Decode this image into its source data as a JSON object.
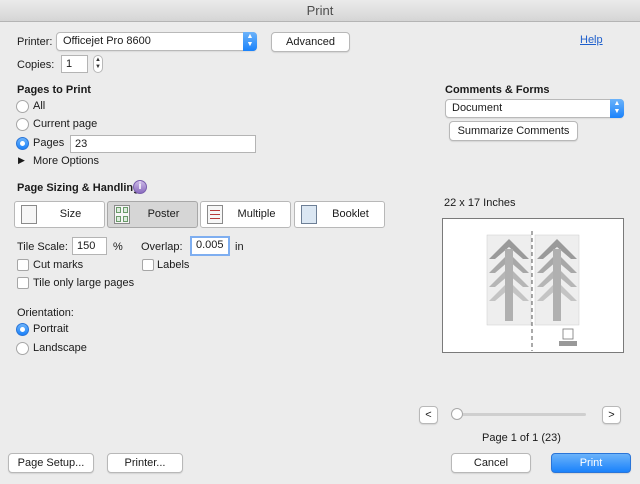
{
  "window": {
    "title": "Print"
  },
  "printer": {
    "label": "Printer:",
    "value": "Officejet Pro 8600",
    "advanced_label": "Advanced"
  },
  "copies": {
    "label": "Copies:",
    "value": "1"
  },
  "help_label": "Help",
  "pages_to_print": {
    "heading": "Pages to Print",
    "all_label": "All",
    "current_label": "Current page",
    "pages_label": "Pages",
    "pages_value": "23",
    "more_options_label": "More Options",
    "selected": "Pages"
  },
  "comments_forms": {
    "heading": "Comments & Forms",
    "value": "Document",
    "summarize_label": "Summarize Comments"
  },
  "sizing": {
    "heading": "Page Sizing & Handling",
    "tabs": [
      {
        "label": "Size",
        "icon": "size-icon"
      },
      {
        "label": "Poster",
        "icon": "poster-icon"
      },
      {
        "label": "Multiple",
        "icon": "multiple-icon"
      },
      {
        "label": "Booklet",
        "icon": "booklet-icon"
      }
    ],
    "selected_tab": "Poster",
    "tile_scale_label": "Tile Scale:",
    "tile_scale_value": "150",
    "tile_scale_unit": "%",
    "overlap_label": "Overlap:",
    "overlap_value": "0.005",
    "overlap_unit": "in",
    "cut_marks_label": "Cut marks",
    "labels_label": "Labels",
    "tile_large_label": "Tile only large pages"
  },
  "orientation": {
    "heading": "Orientation:",
    "portrait_label": "Portrait",
    "landscape_label": "Landscape",
    "selected": "Portrait"
  },
  "preview": {
    "size_label": "22 x 17 Inches",
    "page_status": "Page 1 of 1 (23)",
    "prev_symbol": "<",
    "next_symbol": ">"
  },
  "footer": {
    "page_setup_label": "Page Setup...",
    "printer_label": "Printer...",
    "cancel_label": "Cancel",
    "print_label": "Print"
  },
  "colors": {
    "accent": "#1a82fb",
    "link": "#1e5fcc",
    "background": "#ececec"
  }
}
